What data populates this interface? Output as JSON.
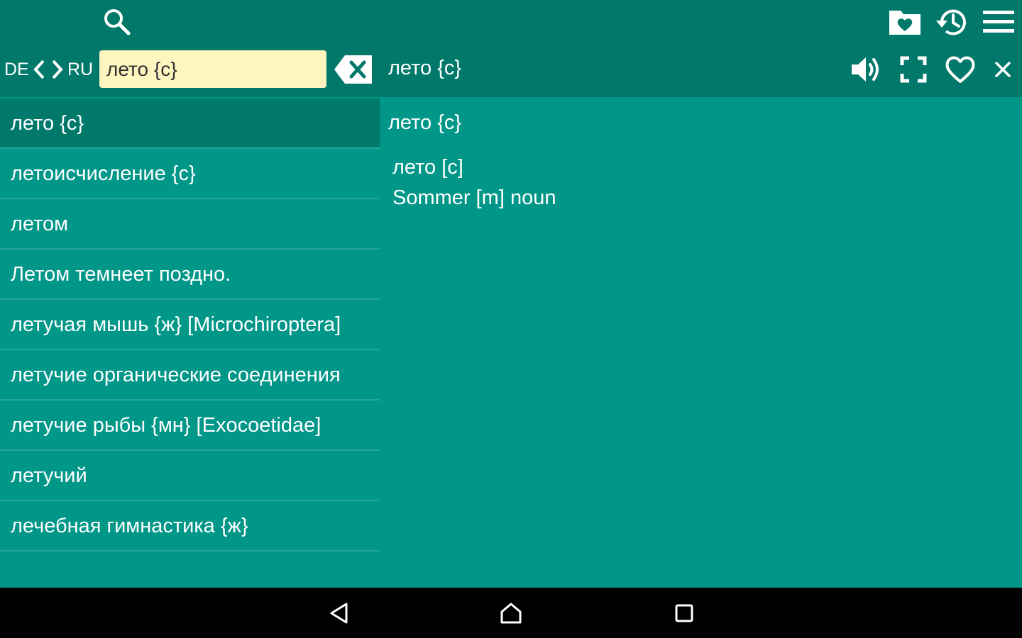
{
  "theme": {
    "header_bg": "#00796b",
    "content_bg": "#009688",
    "input_bg": "#fff6bf",
    "selected_row_bg": "#00796b",
    "divider": "#26a69a",
    "navbar_bg": "#000000"
  },
  "header": {
    "search_icon": "search-icon",
    "actions": [
      "favorites-folder-icon",
      "history-icon",
      "menu-icon"
    ],
    "source_lang": "DE",
    "target_lang": "RU",
    "search": {
      "value": "лето {с}",
      "placeholder": ""
    },
    "current_word": "лето {с}",
    "detail_actions": [
      "speaker-icon",
      "fullscreen-icon",
      "heart-icon",
      "close-icon"
    ]
  },
  "word_list": [
    "лето {с}",
    "летоисчисление {с}",
    "летом",
    "Летом темнеет поздно.",
    "летучая мышь {ж} [Microchiroptera]",
    "летучие органические соединения",
    "летучие рыбы {мн} [Exocoetidae]",
    "летучий",
    "лечебная гимнастика {ж}"
  ],
  "selected_index": 0,
  "detail": {
    "title": "лето {с}",
    "headword": "лето [с]",
    "translation": "Sommer [m] noun"
  },
  "navbar": {
    "buttons": [
      "back-icon",
      "home-icon",
      "recents-icon"
    ]
  }
}
